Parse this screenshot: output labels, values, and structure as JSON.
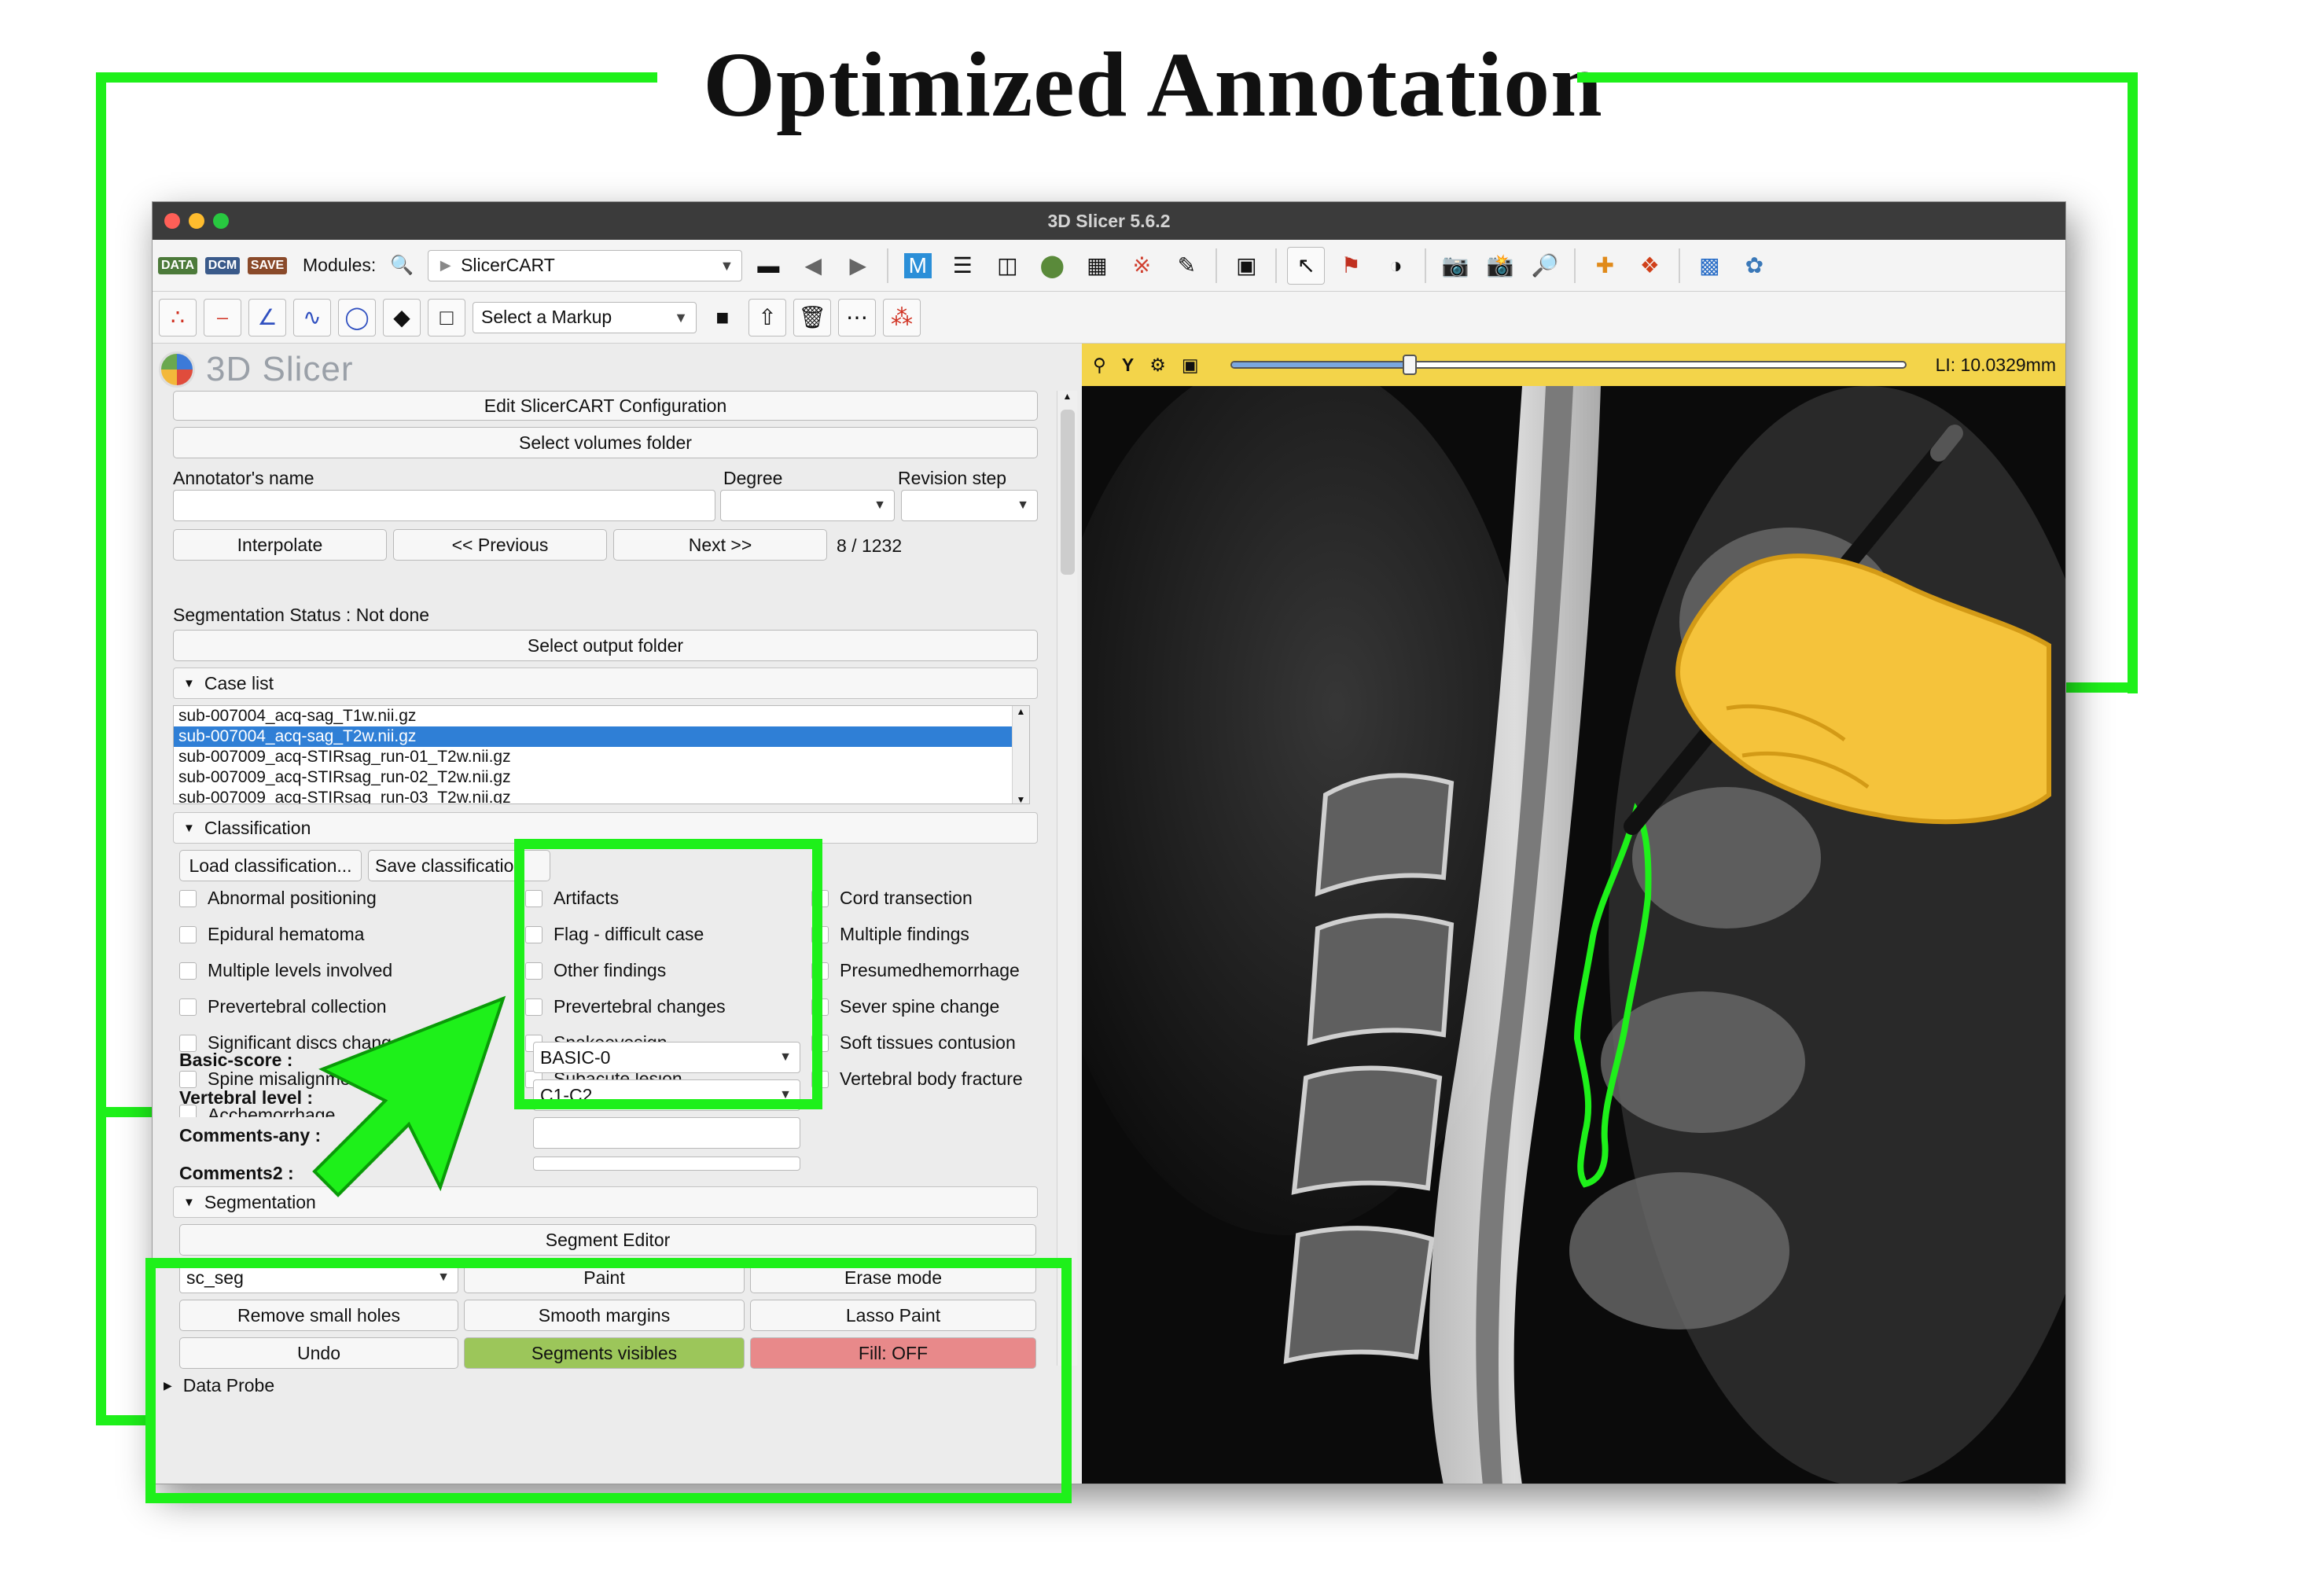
{
  "figure": {
    "title": "Optimized Annotation"
  },
  "window": {
    "title": "3D Slicer 5.6.2"
  },
  "toolbar": {
    "modules_label": "Modules:",
    "module_value": "SlicerCART",
    "data_label": "DATA",
    "dcm_label": "DCM",
    "save_label": "SAVE",
    "markup_select": "Select a Markup"
  },
  "app": {
    "logo_text": "3D Slicer"
  },
  "panel": {
    "edit_config": "Edit SlicerCART Configuration",
    "select_volumes": "Select volumes folder",
    "annotator_label": "Annotator's name",
    "degree_label": "Degree",
    "revision_label": "Revision step",
    "interpolate": "Interpolate",
    "previous": "<<  Previous",
    "next": "Next  >>",
    "counter": "8 / 1232",
    "seg_status": "Segmentation Status : Not done",
    "select_output": "Select output folder",
    "case_list_header": "Case list",
    "cases": [
      "sub-007004_acq-sag_T1w.nii.gz",
      "sub-007004_acq-sag_T2w.nii.gz",
      "sub-007009_acq-STIRsag_run-01_T2w.nii.gz",
      "sub-007009_acq-STIRsag_run-02_T2w.nii.gz",
      "sub-007009_acq-STIRsag_run-03_T2w.nii.gz"
    ],
    "classification_header": "Classification",
    "load_classification": "Load classification...",
    "save_classification": "Save classification",
    "checks_col1": [
      "Abnormal positioning",
      "Epidural hematoma",
      "Multiple levels involved",
      "Prevertebral collection",
      "Significant discs changes",
      "Spine misalignment",
      "Acchemorrhage"
    ],
    "checks_col2": [
      "Artifacts",
      "Flag - difficult case",
      "Other findings",
      "Prevertebral changes",
      "Snakeeyesign",
      "Subacute lesion"
    ],
    "checks_col3": [
      "Cord transection",
      "Multiple findings",
      "Presumedhemorrhage",
      "Sever spine change",
      "Soft tissues contusion",
      "Vertebral body fracture"
    ],
    "basic_score_label": "Basic-score :",
    "basic_score_value": "BASIC-0",
    "vertebral_label": "Vertebral level :",
    "vertebral_value": "C1-C2",
    "comments_any_label": "Comments-any :",
    "comments2_label": "Comments2 :",
    "segmentation_header": "Segmentation",
    "segment_editor": "Segment Editor",
    "segment_select": "sc_seg",
    "paint": "Paint",
    "erase_mode": "Erase mode",
    "remove_small_holes": "Remove small holes",
    "smooth_margins": "Smooth margins",
    "lasso_paint": "Lasso Paint",
    "undo": "Undo",
    "segments_visibles": "Segments visibles",
    "fill_off": "Fill: OFF",
    "data_probe": "Data Probe"
  },
  "view": {
    "axis": "Y",
    "li_readout": "LI: 10.0329mm",
    "slider_fraction": 0.265
  },
  "colors": {
    "highlight_green": "#1ef01a",
    "view_header": "#f3d44a",
    "selected_row": "#2f7fd6",
    "segments_visible_btn": "#9cc65a",
    "fill_off_btn": "#e8898a"
  }
}
